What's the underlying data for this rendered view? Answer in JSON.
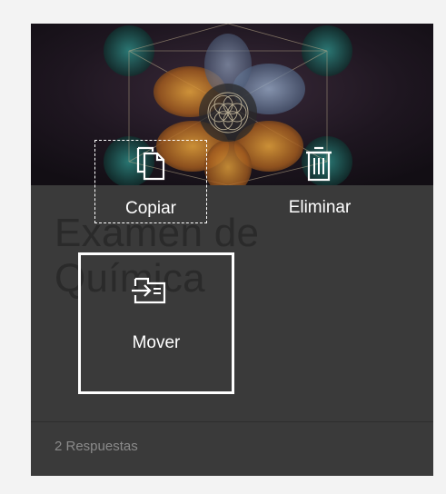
{
  "card": {
    "title_line1": "Examen de",
    "title_line2": "Química",
    "footer": "2 Respuestas"
  },
  "actions": {
    "copy_label": "Copiar",
    "delete_label": "Eliminar",
    "move_label": "Mover"
  },
  "icons": {
    "copy": "copy-icon",
    "delete": "trash-icon",
    "move": "move-icon",
    "banner": "flower-of-life-image"
  }
}
